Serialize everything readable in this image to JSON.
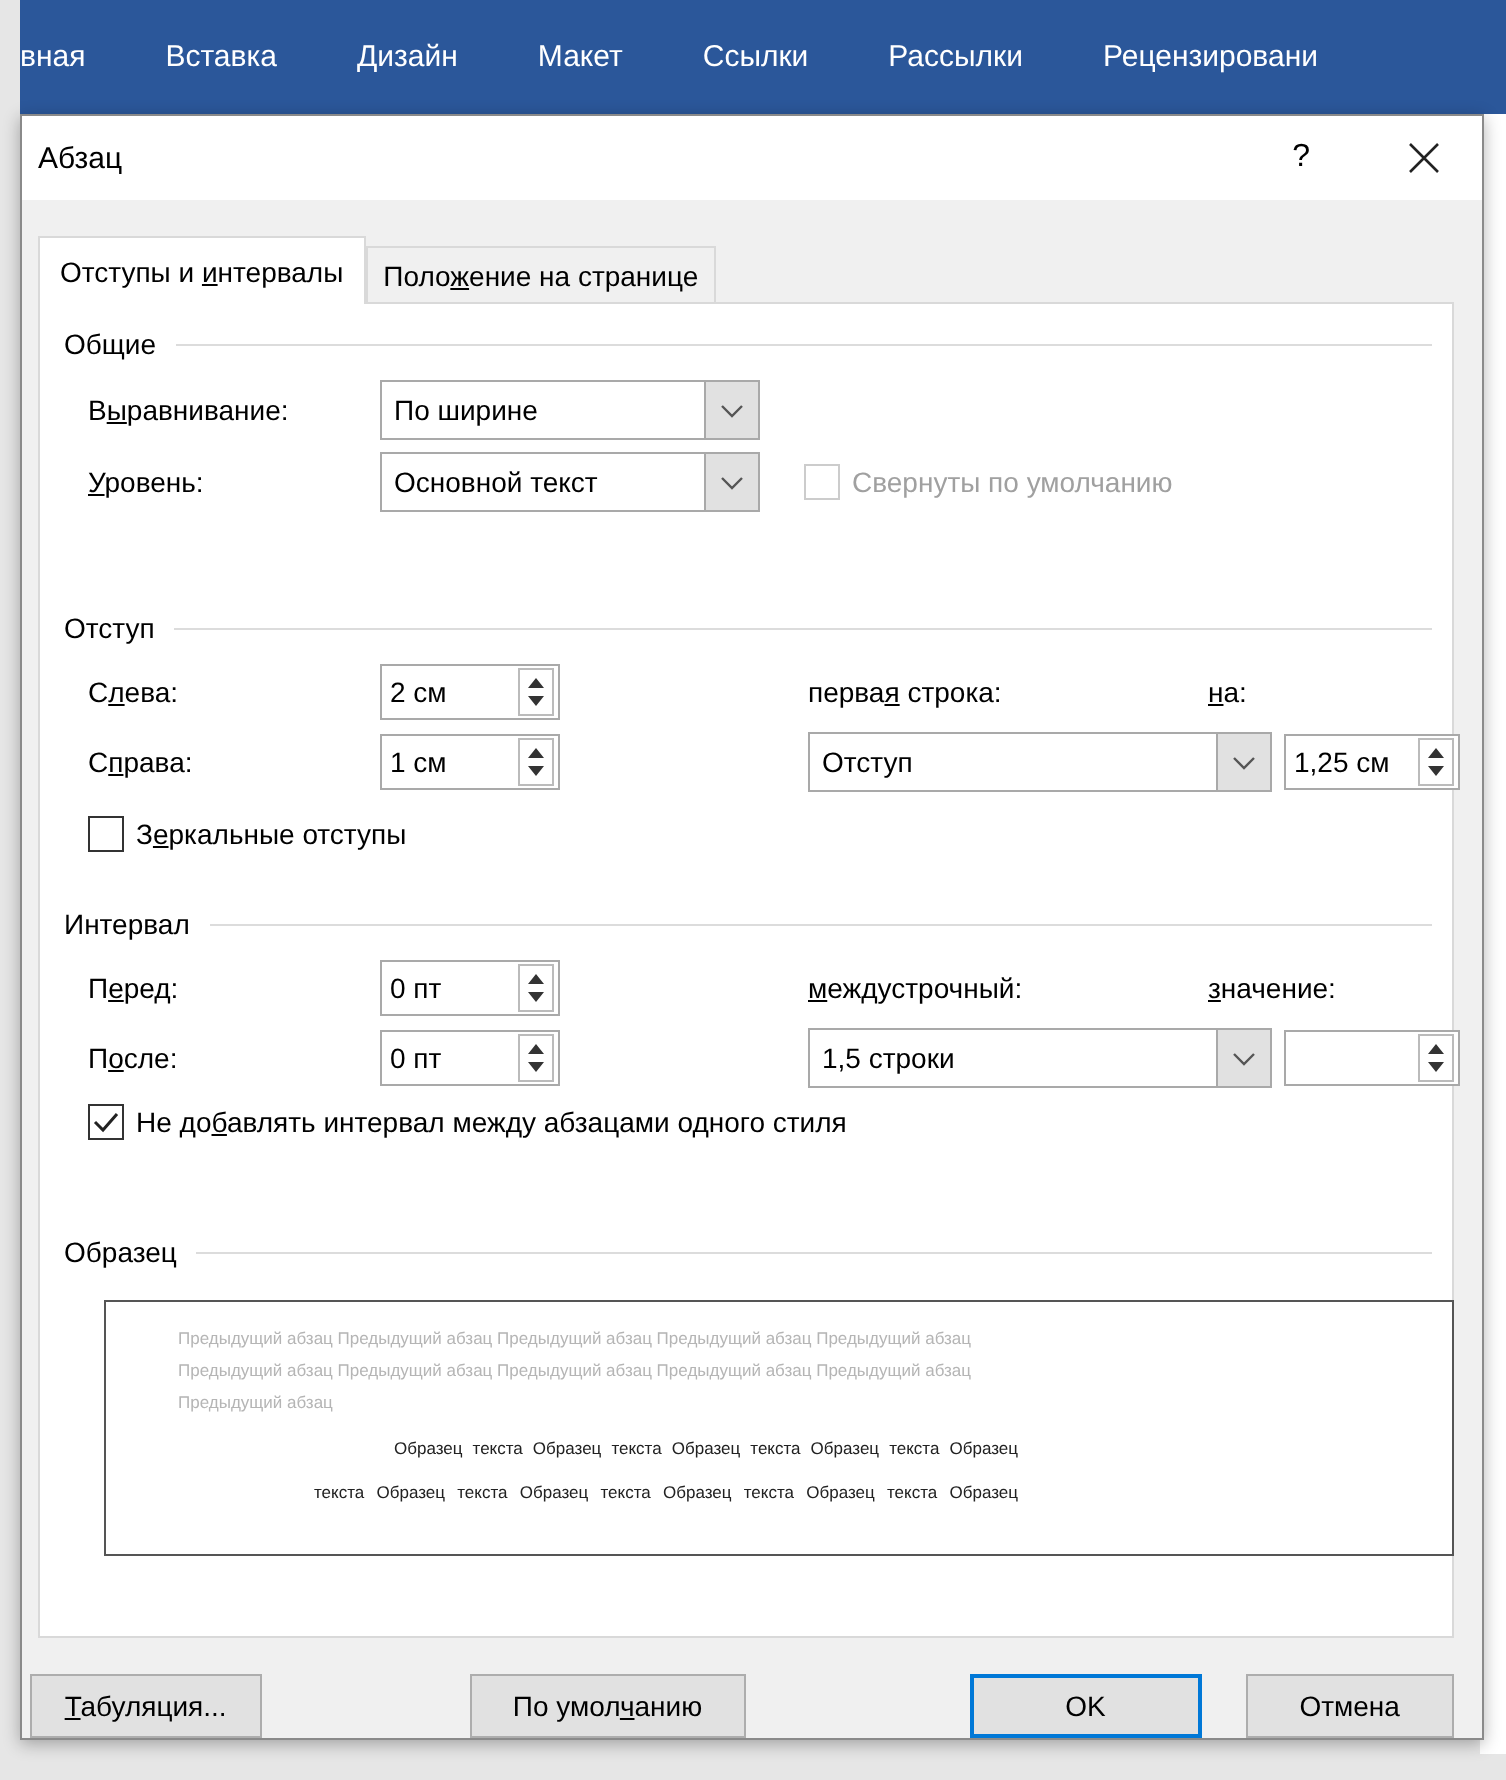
{
  "ribbon": {
    "tabs": [
      "вная",
      "Вставка",
      "Дизайн",
      "Макет",
      "Ссылки",
      "Рассылки",
      "Рецензировани"
    ]
  },
  "dialog": {
    "title": "Абзац",
    "help": "?",
    "tabs": [
      {
        "label": {
          "pre": "Отступы и ",
          "key": "и",
          "post": "нтервалы"
        },
        "selected": true
      },
      {
        "label": {
          "pre": "Поло",
          "key": "ж",
          "post": "ение на странице"
        },
        "selected": false
      }
    ],
    "general": {
      "title": "Общие",
      "alignment": {
        "label": {
          "pre": "В",
          "key": "ы",
          "post": "равнивание:"
        },
        "value": "По ширине"
      },
      "level": {
        "label": {
          "key": "У",
          "post": "ровень:"
        },
        "value": "Основной текст"
      },
      "collapsed": {
        "label": "Свернуты по умолчанию",
        "checked": false,
        "disabled": true
      }
    },
    "indent": {
      "title": "Отступ",
      "left": {
        "label": {
          "pre": "С",
          "key": "л",
          "post": "ева:"
        },
        "value": "2 см"
      },
      "right": {
        "label": {
          "pre": "С",
          "key": "п",
          "post": "рава:"
        },
        "value": "1 см"
      },
      "first_line": {
        "label": {
          "pre": "перва",
          "key": "я",
          "post": " строка:"
        },
        "value": "Отступ"
      },
      "by": {
        "label": {
          "key": "н",
          "post": "а:"
        },
        "value": "1,25 см"
      },
      "mirror": {
        "label": {
          "pre": "З",
          "key": "е",
          "post": "ркальные отступы"
        },
        "checked": false
      }
    },
    "spacing": {
      "title": "Интервал",
      "before": {
        "label": {
          "pre": "П",
          "key": "е",
          "post": "ред:"
        },
        "value": "0 пт"
      },
      "after": {
        "label": {
          "pre": "П",
          "key": "о",
          "post": "сле:"
        },
        "value": "0 пт"
      },
      "line": {
        "label": {
          "key": "м",
          "post": "еждустрочный:"
        },
        "value": "1,5 строки"
      },
      "at": {
        "label": {
          "key": "з",
          "post": "начение:"
        }
      },
      "dont_add": {
        "label": {
          "pre": "Не до",
          "key": "б",
          "post": "авлять интервал между абзацами одного стиля"
        },
        "checked": true
      }
    },
    "preview": {
      "title": "Образец",
      "previous": [
        "Предыдущий абзац Предыдущий абзац Предыдущий абзац Предыдущий абзац Предыдущий абзац",
        "Предыдущий абзац Предыдущий абзац Предыдущий абзац Предыдущий абзац Предыдущий абзац",
        "Предыдущий абзац"
      ],
      "sample": [
        "Образец текста Образец текста Образец текста Образец текста Образец",
        "текста Образец текста Образец текста Образец текста Образец текста Образец"
      ]
    },
    "buttons": [
      {
        "label": {
          "key": "Т",
          "post": "абуляция..."
        },
        "default": false
      },
      {
        "label": {
          "pre": "По умол",
          "key": "ч",
          "post": "анию"
        },
        "default": false
      },
      {
        "label": {
          "pre": "OK"
        },
        "default": true
      },
      {
        "label": {
          "pre": "Отмена"
        },
        "default": false
      }
    ]
  }
}
